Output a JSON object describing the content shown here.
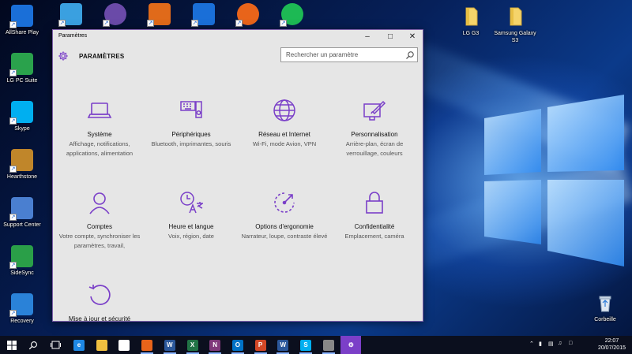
{
  "desktop": {
    "left_icons": [
      {
        "label": "AllShare Play",
        "icon": "allshare-icon",
        "color": "#1a6fd8"
      },
      {
        "label": "LG PC Suite",
        "icon": "lg-pcsuite-icon",
        "color": "#2aa24c"
      },
      {
        "label": "Skype",
        "icon": "skype-icon",
        "color": "#00aff0"
      },
      {
        "label": "Hearthstone",
        "icon": "hearthstone-icon",
        "color": "#c0862a"
      },
      {
        "label": "Support Center",
        "icon": "support-center-icon",
        "color": "#4a7fd0"
      },
      {
        "label": "SideSync",
        "icon": "sidesync-icon",
        "color": "#2a9f48"
      },
      {
        "label": "Recovery",
        "icon": "recovery-icon",
        "color": "#2a82d8"
      }
    ],
    "top_icons": [
      {
        "icon": "app-icon-1",
        "color": "#3aa0e0"
      },
      {
        "icon": "app-icon-2",
        "color": "#6a4aa8"
      },
      {
        "icon": "kies-icon",
        "color": "#e06a1a"
      },
      {
        "icon": "lightning-app-icon",
        "color": "#1a6fd8"
      },
      {
        "icon": "firefox-icon",
        "color": "#e8641a"
      },
      {
        "icon": "spotify-icon",
        "color": "#1db954"
      }
    ],
    "right_icons": [
      {
        "label": "LG G3",
        "icon": "folder-icon"
      },
      {
        "label": "Samsung Galaxy S3",
        "icon": "folder-icon"
      }
    ],
    "recycle_bin": {
      "label": "Corbeille",
      "icon": "recycle-bin-icon"
    }
  },
  "window": {
    "title": "Paramètres",
    "heading": "PARAMÈTRES",
    "search": {
      "placeholder": "Rechercher un paramètre"
    },
    "accent": "#7a3fc8",
    "tiles": [
      {
        "name": "Système",
        "desc": "Affichage, notifications, applications, alimentation",
        "icon": "laptop-icon"
      },
      {
        "name": "Périphériques",
        "desc": "Bluetooth, imprimantes, souris",
        "icon": "devices-icon"
      },
      {
        "name": "Réseau et Internet",
        "desc": "Wi-Fi, mode Avion, VPN",
        "icon": "globe-icon"
      },
      {
        "name": "Personnalisation",
        "desc": "Arrière-plan, écran de verrouillage, couleurs",
        "icon": "personalization-icon"
      },
      {
        "name": "Comptes",
        "desc": "Votre compte, synchroniser les paramètres, travail,",
        "icon": "person-icon"
      },
      {
        "name": "Heure et langue",
        "desc": "Voix, région, date",
        "icon": "time-language-icon"
      },
      {
        "name": "Options d'ergonomie",
        "desc": "Narrateur, loupe, contraste élevé",
        "icon": "ease-of-access-icon"
      },
      {
        "name": "Confidentialité",
        "desc": "Emplacement, caméra",
        "icon": "lock-icon"
      },
      {
        "name": "Mise à jour et sécurité",
        "desc": "",
        "icon": "update-icon"
      }
    ]
  },
  "taskbar": {
    "apps": [
      {
        "icon": "edge-icon",
        "color": "#1e88e5",
        "glyph": "e"
      },
      {
        "icon": "file-explorer-icon",
        "color": "#f0c040",
        "glyph": ""
      },
      {
        "icon": "store-icon",
        "color": "#ffffff",
        "glyph": ""
      },
      {
        "icon": "firefox-icon",
        "color": "#e8641a",
        "glyph": ""
      },
      {
        "icon": "word-icon",
        "color": "#2b579a",
        "glyph": "W"
      },
      {
        "icon": "excel-icon",
        "color": "#217346",
        "glyph": "X"
      },
      {
        "icon": "onenote-icon",
        "color": "#80397b",
        "glyph": "N"
      },
      {
        "icon": "outlook-icon",
        "color": "#0072c6",
        "glyph": "O"
      },
      {
        "icon": "powerpoint-icon",
        "color": "#d24726",
        "glyph": "P"
      },
      {
        "icon": "word-doc-icon",
        "color": "#2b579a",
        "glyph": "W"
      },
      {
        "icon": "skype-icon",
        "color": "#00aff0",
        "glyph": "S"
      },
      {
        "icon": "app-icon",
        "color": "#888888",
        "glyph": ""
      },
      {
        "icon": "settings-icon",
        "color": "#7b3fc8",
        "glyph": "⚙"
      }
    ],
    "time": "22:07",
    "date": "20/07/2015"
  }
}
